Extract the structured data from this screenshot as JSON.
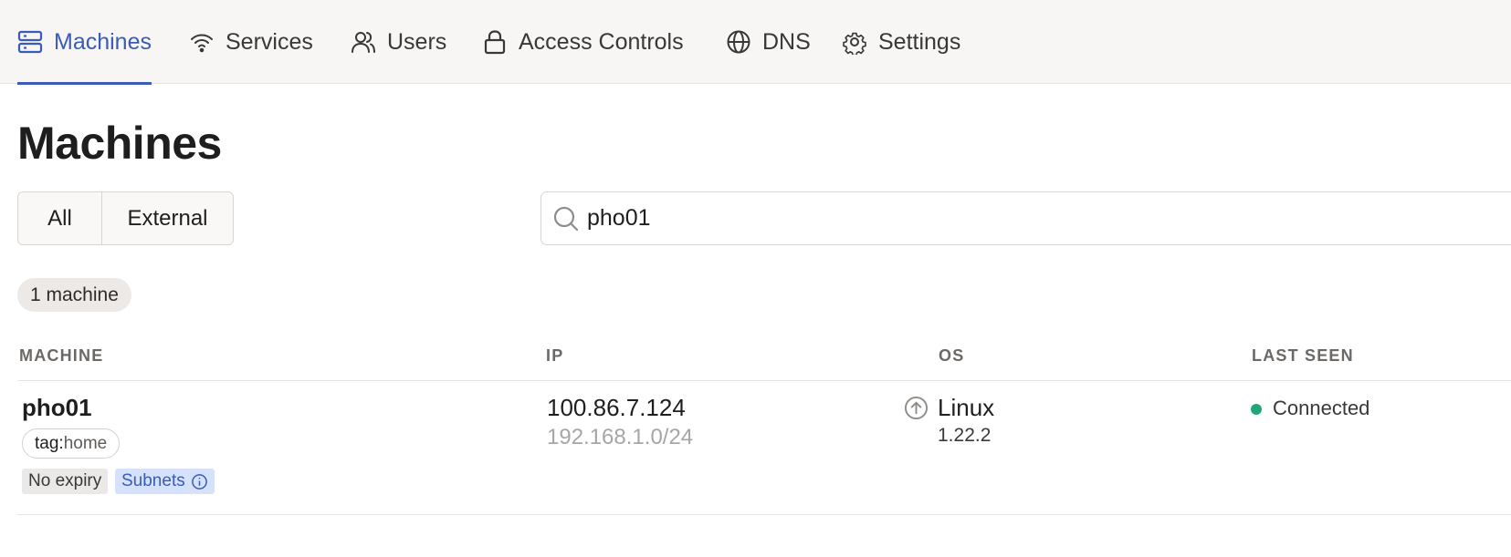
{
  "nav": {
    "items": [
      {
        "label": "Machines",
        "icon": "server-icon"
      },
      {
        "label": "Services",
        "icon": "wifi-icon"
      },
      {
        "label": "Users",
        "icon": "users-icon"
      },
      {
        "label": "Access Controls",
        "icon": "lock-icon"
      },
      {
        "label": "DNS",
        "icon": "globe-icon"
      },
      {
        "label": "Settings",
        "icon": "gear-icon"
      }
    ],
    "active": "Machines"
  },
  "page": {
    "title": "Machines"
  },
  "filters": {
    "all_label": "All",
    "external_label": "External"
  },
  "search": {
    "value": "pho01",
    "icon": "search-icon"
  },
  "count_label": "1 machine",
  "table": {
    "headers": {
      "machine": "MACHINE",
      "ip": "IP",
      "os": "OS",
      "last_seen": "LAST SEEN"
    },
    "rows": [
      {
        "name": "pho01",
        "tag_key": "tag:",
        "tag_value": "home",
        "expiry_badge": "No expiry",
        "subnets_badge": "Subnets",
        "ip": "100.86.7.124",
        "subnet": "192.168.1.0/24",
        "os": "Linux",
        "os_version": "1.22.2",
        "last_seen": "Connected"
      }
    ]
  },
  "colors": {
    "accent": "#3a5bb8",
    "connected": "#1fa774"
  }
}
